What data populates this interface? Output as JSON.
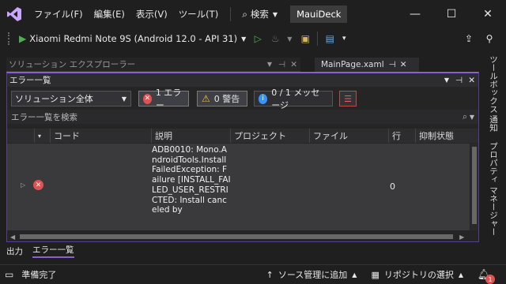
{
  "colors": {
    "accent": "#8a5fd4",
    "error_red": "#e05252",
    "warning_yellow": "#f0c040",
    "info_blue": "#3794ff",
    "run_green": "#4caf50"
  },
  "titlebar": {
    "logo_icon": "visual-studio-logo",
    "menu": [
      "ファイル(F)",
      "編集(E)",
      "表示(V)",
      "ツール(T)"
    ],
    "search_label": "検索",
    "project_name": "MauiDeck",
    "window_controls": [
      "minimize",
      "maximize",
      "close"
    ]
  },
  "toolbar": {
    "run_target": "Xiaomi Redmi Note 9S (Android 12.0 - API 31)"
  },
  "solution_explorer": {
    "title": "ソリューション エクスプローラー"
  },
  "document_tab": {
    "label": "MainPage.xaml"
  },
  "error_list": {
    "title": "エラー一覧",
    "scope": "ソリューション全体",
    "errors_chip": "1 エラー",
    "warnings_chip": "0 警告",
    "messages_chip": "0 / 1 メッセージ",
    "search_placeholder": "エラー一覧を検索",
    "columns": [
      "コード",
      "説明",
      "プロジェクト",
      "ファイル",
      "行",
      "抑制状態"
    ],
    "rows": [
      {
        "code": "",
        "description": "ADB0010: Mono.AndroidTools.InstallFailedException: Failure [INSTALL_FAILED_USER_RESTRICTED: Install canceled by",
        "project": "",
        "file": "",
        "line": "0",
        "suppression": ""
      }
    ]
  },
  "right_tabs": [
    "ツールボックス",
    "通知",
    "プロパティ マネージャー"
  ],
  "bottom_tabs": [
    "出力",
    "エラー一覧"
  ],
  "statusbar": {
    "ready": "準備完了",
    "source_control": "ソース管理に追加",
    "repository": "リポジトリの選択",
    "notification_count": "1"
  }
}
